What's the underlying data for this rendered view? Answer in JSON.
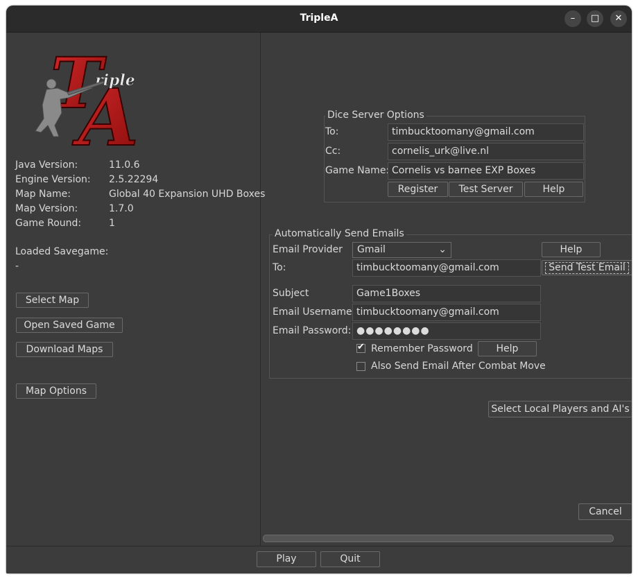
{
  "window": {
    "title": "TripleA"
  },
  "titlebar_controls": {
    "minimize": "–",
    "maximize": "□",
    "close": "✕"
  },
  "logo": {
    "letter_t": "T",
    "letter_a": "A",
    "word": "riple"
  },
  "info": {
    "java_version_label": "Java Version:",
    "java_version": "11.0.6",
    "engine_version_label": "Engine Version:",
    "engine_version": "2.5.22294",
    "map_name_label": "Map Name:",
    "map_name": "Global 40 Expansion UHD Boxes",
    "map_version_label": "Map Version:",
    "map_version": "1.7.0",
    "game_round_label": "Game Round:",
    "game_round": "1",
    "loaded_savegame_label": "Loaded Savegame:",
    "loaded_savegame": "-"
  },
  "left_buttons": {
    "select_map": "Select Map",
    "open_saved_game": "Open Saved Game",
    "download_maps": "Download Maps",
    "map_options": "Map Options"
  },
  "dice": {
    "title": "Dice Server Options",
    "to_label": "To:",
    "to_value": "timbucktoomany@gmail.com",
    "cc_label": "Cc:",
    "cc_value": "cornelis_urk@live.nl",
    "game_name_label": "Game Name:",
    "game_name_value": "Cornelis vs barnee EXP Boxes",
    "register": "Register",
    "test_server": "Test Server",
    "help": "Help"
  },
  "email": {
    "title": "Automatically Send Emails",
    "provider_label": "Email Provider",
    "provider_value": "Gmail",
    "provider_help": "Help",
    "to_label": "To:",
    "to_value": "timbucktoomany@gmail.com",
    "send_test_email": "Send Test Email",
    "subject_label": "Subject",
    "subject_value": "Game1Boxes",
    "username_label": "Email Username:",
    "username_value": "timbucktoomany@gmail.com",
    "password_label": "Email Password:",
    "password_value": "●●●●●●●●",
    "remember_password_label": "Remember Password",
    "remember_password_checked": true,
    "remember_help": "Help",
    "after_combat_label": "Also Send Email After Combat Move",
    "after_combat_checked": false
  },
  "select_players": "Select Local Players and AI's",
  "cancel": "Cancel",
  "bottom": {
    "play": "Play",
    "quit": "Quit"
  }
}
